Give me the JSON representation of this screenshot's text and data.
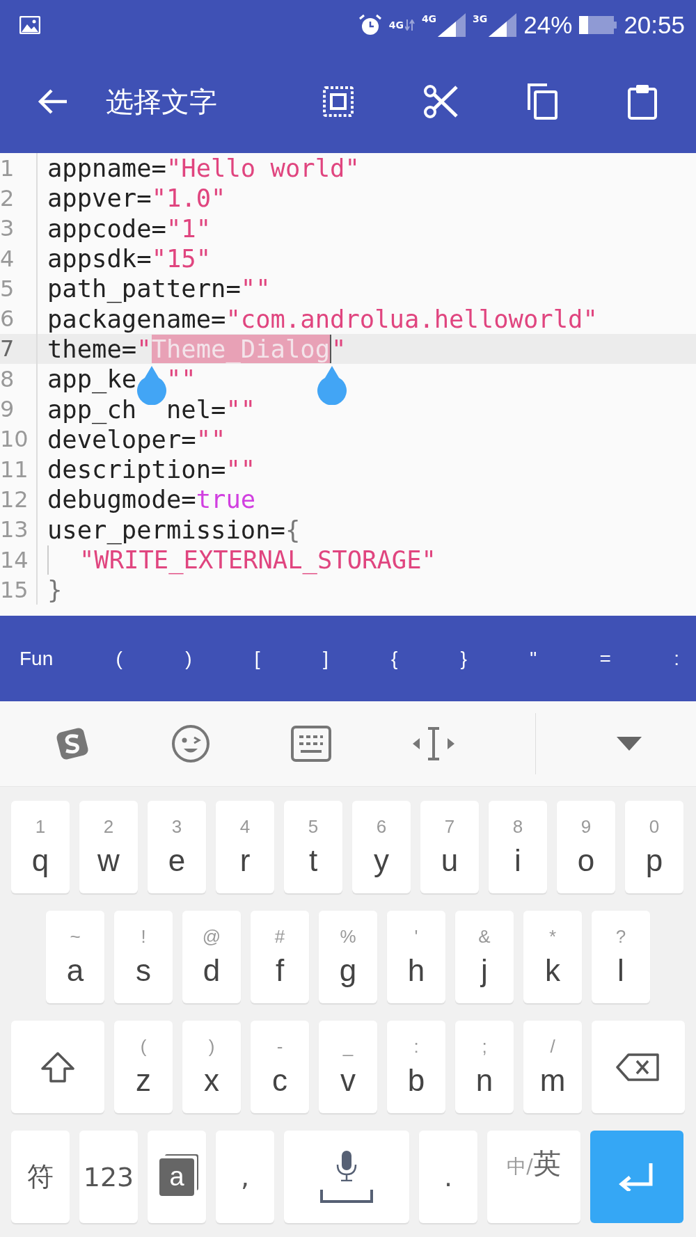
{
  "status_bar": {
    "networks": [
      {
        "label": "4G"
      },
      {
        "label": "4G"
      },
      {
        "label": "3G"
      }
    ],
    "battery": "24%",
    "time": "20:55"
  },
  "toolbar": {
    "title": "选择文字"
  },
  "editor": {
    "lines": [
      {
        "number": "1",
        "current": false,
        "tokens": [
          {
            "kind": "plain",
            "text": "appname="
          },
          {
            "kind": "string",
            "text": "\"Hello world\""
          }
        ]
      },
      {
        "number": "2",
        "current": false,
        "tokens": [
          {
            "kind": "plain",
            "text": "appver="
          },
          {
            "kind": "string",
            "text": "\"1.0\""
          }
        ]
      },
      {
        "number": "3",
        "current": false,
        "tokens": [
          {
            "kind": "plain",
            "text": "appcode="
          },
          {
            "kind": "string",
            "text": "\"1\""
          }
        ]
      },
      {
        "number": "4",
        "current": false,
        "tokens": [
          {
            "kind": "plain",
            "text": "appsdk="
          },
          {
            "kind": "string",
            "text": "\"15\""
          }
        ]
      },
      {
        "number": "5",
        "current": false,
        "tokens": [
          {
            "kind": "plain",
            "text": "path_pattern="
          },
          {
            "kind": "string",
            "text": "\"\""
          }
        ]
      },
      {
        "number": "6",
        "current": false,
        "tokens": [
          {
            "kind": "plain",
            "text": "packagename="
          },
          {
            "kind": "string",
            "text": "\"com.androlua.helloworld\""
          }
        ]
      },
      {
        "number": "7",
        "current": true,
        "tokens": [
          {
            "kind": "plain",
            "text": "theme="
          },
          {
            "kind": "string",
            "text": "\""
          },
          {
            "kind": "selected",
            "text": "Theme_Dialog"
          },
          {
            "kind": "string",
            "text": "\""
          }
        ]
      },
      {
        "number": "8",
        "current": false,
        "tokens": [
          {
            "kind": "plain",
            "text": "app_ke"
          },
          {
            "kind": "gap"
          },
          {
            "kind": "string",
            "text": "\"\""
          }
        ]
      },
      {
        "number": "9",
        "current": false,
        "tokens": [
          {
            "kind": "plain",
            "text": "app_ch"
          },
          {
            "kind": "gap"
          },
          {
            "kind": "plain",
            "text": "nel="
          },
          {
            "kind": "string",
            "text": "\"\""
          }
        ]
      },
      {
        "number": "10",
        "current": false,
        "tokens": [
          {
            "kind": "plain",
            "text": "developer="
          },
          {
            "kind": "string",
            "text": "\"\""
          }
        ]
      },
      {
        "number": "11",
        "current": false,
        "tokens": [
          {
            "kind": "plain",
            "text": "description="
          },
          {
            "kind": "string",
            "text": "\"\""
          }
        ]
      },
      {
        "number": "12",
        "current": false,
        "tokens": [
          {
            "kind": "plain",
            "text": "debugmode="
          },
          {
            "kind": "keyword",
            "text": "true"
          }
        ]
      },
      {
        "number": "13",
        "current": false,
        "tokens": [
          {
            "kind": "plain",
            "text": "user_permission="
          },
          {
            "kind": "brace",
            "text": "{"
          }
        ]
      },
      {
        "number": "14",
        "current": false,
        "tokens": [
          {
            "kind": "indent"
          },
          {
            "kind": "string",
            "text": "\"WRITE_EXTERNAL_STORAGE\""
          }
        ]
      },
      {
        "number": "15",
        "current": false,
        "tokens": [
          {
            "kind": "brace",
            "text": "}"
          }
        ]
      }
    ]
  },
  "symbol_bar": {
    "keys": [
      "Fun",
      "(",
      ")",
      "[",
      "]",
      "{",
      "}",
      "\"",
      "=",
      ":"
    ]
  },
  "keyboard": {
    "rows": [
      [
        {
          "kind": "letter",
          "hint": "1",
          "label": "q"
        },
        {
          "kind": "letter",
          "hint": "2",
          "label": "w"
        },
        {
          "kind": "letter",
          "hint": "3",
          "label": "e"
        },
        {
          "kind": "letter",
          "hint": "4",
          "label": "r"
        },
        {
          "kind": "letter",
          "hint": "5",
          "label": "t"
        },
        {
          "kind": "letter",
          "hint": "6",
          "label": "y"
        },
        {
          "kind": "letter",
          "hint": "7",
          "label": "u"
        },
        {
          "kind": "letter",
          "hint": "8",
          "label": "i"
        },
        {
          "kind": "letter",
          "hint": "9",
          "label": "o"
        },
        {
          "kind": "letter",
          "hint": "0",
          "label": "p"
        }
      ],
      [
        {
          "kind": "letter",
          "hint": "~",
          "label": "a"
        },
        {
          "kind": "letter",
          "hint": "!",
          "label": "s"
        },
        {
          "kind": "letter",
          "hint": "@",
          "label": "d"
        },
        {
          "kind": "letter",
          "hint": "#",
          "label": "f"
        },
        {
          "kind": "letter",
          "hint": "%",
          "label": "g"
        },
        {
          "kind": "letter",
          "hint": "'",
          "label": "h"
        },
        {
          "kind": "letter",
          "hint": "&",
          "label": "j"
        },
        {
          "kind": "letter",
          "hint": "*",
          "label": "k"
        },
        {
          "kind": "letter",
          "hint": "?",
          "label": "l"
        }
      ],
      [
        {
          "kind": "shift"
        },
        {
          "kind": "letter",
          "hint": "(",
          "label": "z"
        },
        {
          "kind": "letter",
          "hint": ")",
          "label": "x"
        },
        {
          "kind": "letter",
          "hint": "-",
          "label": "c"
        },
        {
          "kind": "letter",
          "hint": "_",
          "label": "v"
        },
        {
          "kind": "letter",
          "hint": ":",
          "label": "b"
        },
        {
          "kind": "letter",
          "hint": ";",
          "label": "n"
        },
        {
          "kind": "letter",
          "hint": "/",
          "label": "m"
        },
        {
          "kind": "backspace"
        }
      ]
    ],
    "bottom_row": [
      {
        "kind": "text",
        "label": "符"
      },
      {
        "kind": "text",
        "label": "123"
      },
      {
        "kind": "dictionary",
        "label": "a"
      },
      {
        "kind": "text",
        "label": ","
      },
      {
        "kind": "space"
      },
      {
        "kind": "text",
        "label": "."
      },
      {
        "kind": "lang",
        "small": "中/",
        "label": "英"
      },
      {
        "kind": "enter"
      }
    ]
  }
}
